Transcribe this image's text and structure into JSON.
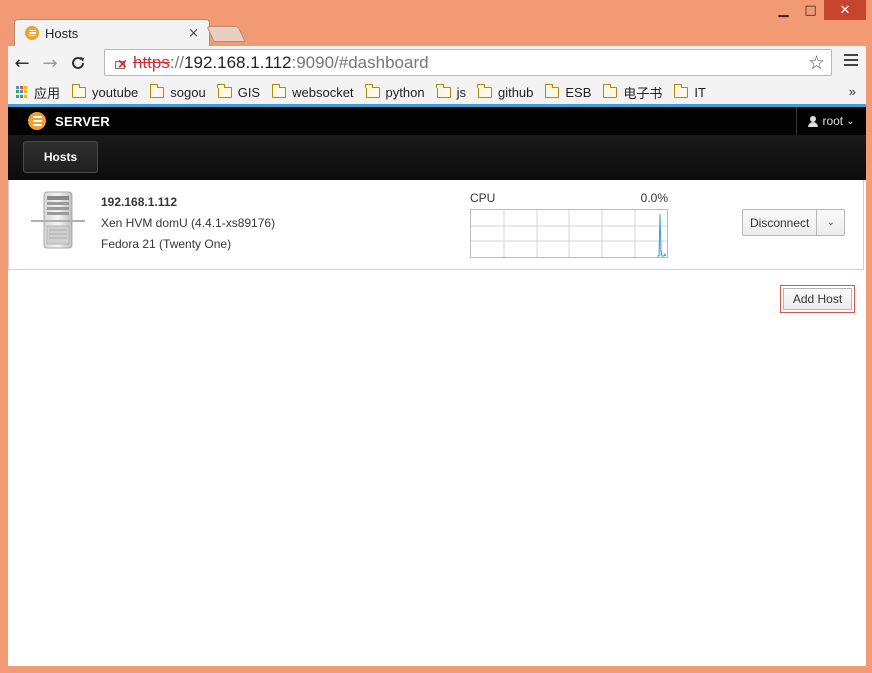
{
  "window": {
    "minimize_glyph": "▁",
    "maximize_glyph": "□",
    "close_glyph": "✕",
    "frame_color": "#f29a73"
  },
  "tab": {
    "title": "Hosts",
    "close_glyph": "×",
    "favicon": "cockpit-logo-icon"
  },
  "toolbar": {
    "back_glyph": "←",
    "forward_glyph": "→",
    "reload_glyph": "C",
    "url_scheme": "https",
    "url_sep": "://",
    "url_host": "192.168.1.112",
    "url_port": ":9090",
    "url_path": "/#dashboard",
    "star_glyph": "☆"
  },
  "bookmarks": {
    "apps_label": "应用",
    "items": [
      "youtube",
      "sogou",
      "GIS",
      "websocket",
      "python",
      "js",
      "github",
      "ESB",
      "电子书",
      "IT"
    ],
    "more_glyph": "»"
  },
  "app": {
    "brand": "SERVER",
    "user": "root",
    "user_caret": "⌄",
    "nav_tab": "Hosts",
    "accent_color": "#3f9fd6",
    "brand_color": "#f0a030"
  },
  "host": {
    "name": "192.168.1.112",
    "hardware": "Xen HVM domU (4.4.1-xs89176)",
    "os": "Fedora 21 (Twenty One)",
    "cpu_label": "CPU",
    "cpu_value": "0.0%",
    "disconnect_label": "Disconnect",
    "caret_glyph": "⌄"
  },
  "actions": {
    "add_host_label": "Add Host"
  }
}
